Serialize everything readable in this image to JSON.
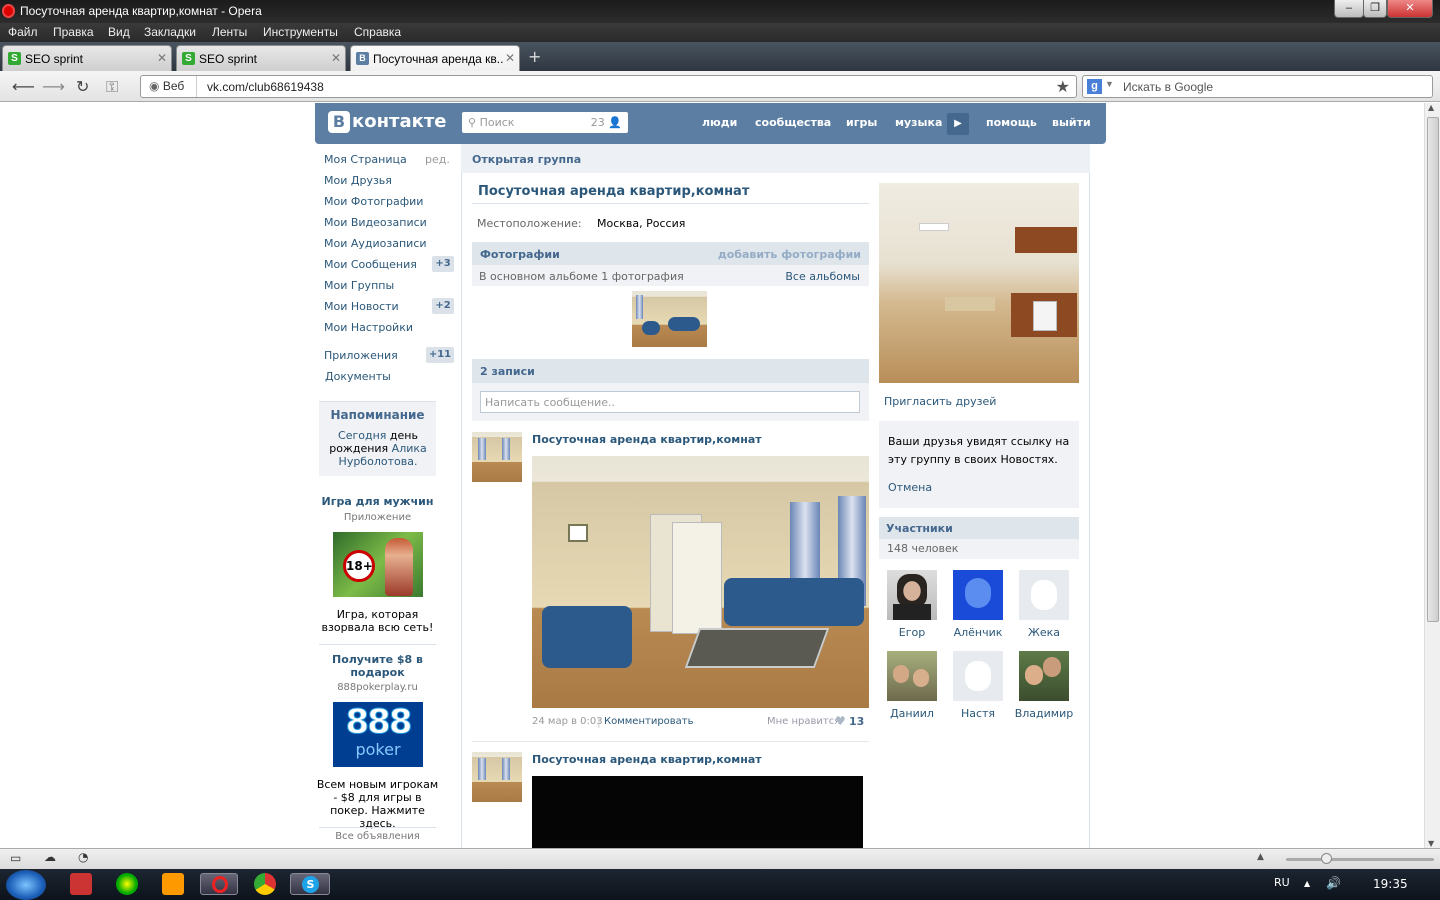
{
  "window": {
    "title": "Посуточная аренда квартир,комнат - Opera"
  },
  "menu": [
    "Файл",
    "Правка",
    "Вид",
    "Закладки",
    "Ленты",
    "Инструменты",
    "Справка"
  ],
  "tabs": [
    {
      "label": "SEO sprint"
    },
    {
      "label": "SEO sprint"
    },
    {
      "label": "Посуточная аренда кв..."
    }
  ],
  "address": {
    "web_label": "Веб",
    "url": "vk.com/club68619438",
    "search_placeholder": "Искать в Google"
  },
  "vk": {
    "logo": "контакте",
    "search_placeholder": "Поиск",
    "search_count": "23",
    "nav": [
      "люди",
      "сообщества",
      "игры",
      "музыка",
      "помощь",
      "выйти"
    ]
  },
  "left_menu": {
    "edit": "ред.",
    "items": [
      {
        "label": "Моя Страница"
      },
      {
        "label": "Мои Друзья"
      },
      {
        "label": "Мои Фотографии"
      },
      {
        "label": "Мои Видеозаписи"
      },
      {
        "label": "Мои Аудиозаписи"
      },
      {
        "label": "Мои Сообщения",
        "badge": "+3"
      },
      {
        "label": "Мои Группы"
      },
      {
        "label": "Мои Новости",
        "badge": "+2"
      },
      {
        "label": "Мои Настройки"
      },
      {
        "label": "Приложения",
        "badge": "+11"
      },
      {
        "label": "Документы"
      }
    ]
  },
  "reminder": {
    "title": "Напоминание",
    "l1": "Сегодня",
    "l2": "день",
    "l3": "рождения",
    "l4": "Алика",
    "l5": "Нурболотова."
  },
  "ads": [
    {
      "title": "Игра для мужчин",
      "sub": "Приложение",
      "badge": "18+",
      "desc": "Игра, которая взорвала всю сеть!"
    },
    {
      "title": "Получите $8 в подарок",
      "sub": "888pokerplay.ru",
      "logo1": "888",
      "logo2": "poker",
      "desc": "Всем новым игрокам - $8 для игры в покер. Нажмите здесь."
    }
  ],
  "all_ads": "Все объявления",
  "group": {
    "type": "Открытая группа",
    "name": "Посуточная аренда квартир,комнат",
    "location_label": "Местоположение:",
    "location": "Москва, Россия",
    "photos_header": "Фотографии",
    "add_photos": "добавить фотографии",
    "album_info": "В основном альбоме 1 фотография",
    "all_albums": "Все альбомы",
    "posts_header": "2 записи",
    "write_placeholder": "Написать сообщение.."
  },
  "posts": [
    {
      "author": "Посуточная аренда квартир,комнат",
      "date": "24 мар в 0:03",
      "comment": "Комментировать",
      "like_label": "Мне нравится",
      "likes": "13"
    },
    {
      "author": "Посуточная аренда квартир,комнат"
    }
  ],
  "right": {
    "invite": "Пригласить друзей",
    "info": "Ваши друзья увидят ссылку на эту группу в своих Новостях.",
    "cancel": "Отмена",
    "members_header": "Участники",
    "members_count": "148 человек",
    "members": [
      "Егор",
      "Алёнчик",
      "Жека",
      "Даниил",
      "Настя",
      "Владимир"
    ]
  },
  "taskbar": {
    "lang": "RU",
    "time": "19:35"
  }
}
